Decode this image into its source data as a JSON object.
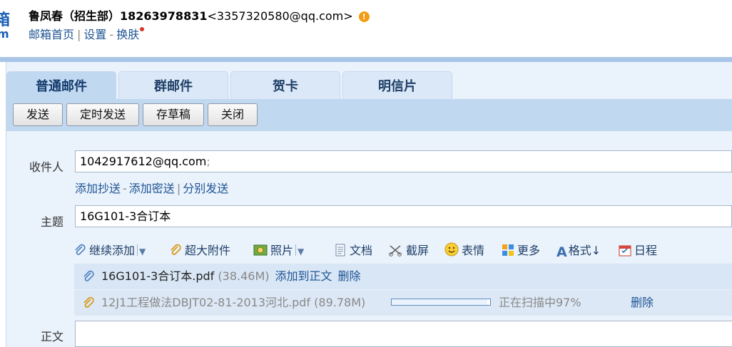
{
  "header": {
    "logo_glyphs": [
      "箱",
      "m"
    ],
    "user_name": "鲁凤春（招生部）18263978831",
    "user_email": "<3357320580@qq.com>",
    "warn_symbol": "!",
    "links": {
      "home": "邮箱首页",
      "settings": "设置",
      "skin": "换肤"
    },
    "separators": {
      "pipe": "|",
      "dash": "-"
    }
  },
  "tabs": [
    {
      "label": "普通邮件",
      "active": true
    },
    {
      "label": "群邮件",
      "active": false
    },
    {
      "label": "贺卡",
      "active": false
    },
    {
      "label": "明信片",
      "active": false
    }
  ],
  "toolbar": {
    "send": "发送",
    "schedule": "定时发送",
    "draft": "存草稿",
    "close": "关闭"
  },
  "compose": {
    "to_label": "收件人",
    "to_value": "1042917612@qq.com",
    "to_separator": ";",
    "cc_links": {
      "add_cc": "添加抄送",
      "add_bcc": "添加密送",
      "separate": "分别发送"
    },
    "subject_label": "主题",
    "subject_value": "16G101-3合订本",
    "body_label": "正文"
  },
  "attach_toolbar": {
    "continue_add": "继续添加",
    "large_file": "超大附件",
    "photo": "照片",
    "document": "文档",
    "screenshot": "截屏",
    "emoji": "表情",
    "more": "更多",
    "format": "格式↓",
    "calendar": "日程"
  },
  "attachments": [
    {
      "name": "16G101-3合订本.pdf",
      "size": "(38.46M)",
      "add_action": "添加到正文",
      "delete": "删除"
    },
    {
      "name": "12J1工程做法DBJT02-81-2013河北.pdf",
      "size": "(89.78M)",
      "progress": 0.97,
      "status": "正在扫描中97%",
      "delete": "删除"
    }
  ],
  "colors": {
    "link": "#1e5494",
    "panel": "#eaf2fb",
    "toolbar": "#c1d8f1",
    "warning": "#f39c12"
  }
}
